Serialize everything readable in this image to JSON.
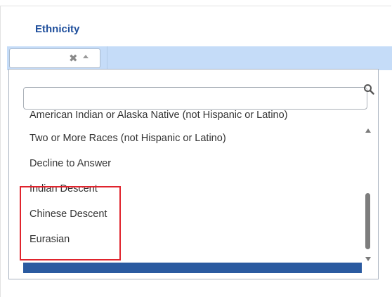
{
  "column": {
    "header": "Ethnicity"
  },
  "filter": {
    "clear_icon": "close-icon",
    "caret_icon": "caret-up-icon"
  },
  "dropdown": {
    "search_value": "",
    "search_icon": "search-icon",
    "options": [
      "American Indian or Alaska Native (not Hispanic or Latino)",
      "Two or More Races (not Hispanic or Latino)",
      "Decline to Answer",
      "Indian Descent",
      "Chinese Descent",
      "Eurasian"
    ],
    "highlighted_options": [
      "Indian Descent",
      "Chinese Descent",
      "Eurasian"
    ]
  },
  "colors": {
    "header_text": "#1f4f9c",
    "filter_bar": "#c5dcf8",
    "selected_bar": "#2a5aa0",
    "highlight_border": "#e0242d"
  }
}
